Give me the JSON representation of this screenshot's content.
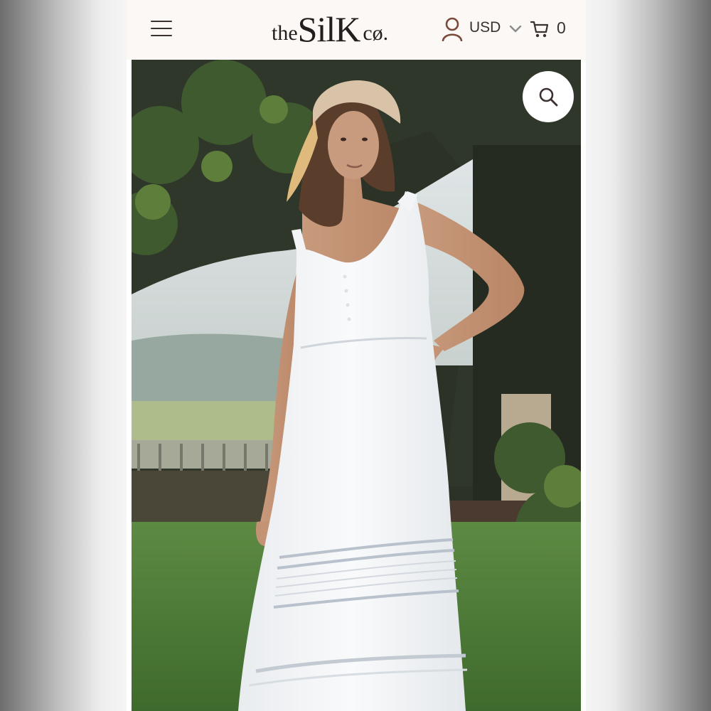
{
  "header": {
    "menu_icon": "hamburger-menu-icon",
    "logo": {
      "the": "the",
      "silk": "SilK",
      "co": "cø."
    },
    "account_icon": "user-icon",
    "currency": "USD",
    "currency_dropdown_icon": "chevron-down-icon",
    "cart_icon": "cart-icon",
    "cart_count": "0"
  },
  "hero": {
    "image_subject": "model-in-white-cotton-maxi-dress",
    "search_icon": "search-icon"
  },
  "colors": {
    "header_bg": "#fbf8f5",
    "text_dark": "#3b3230",
    "logo": "#241d1d"
  }
}
